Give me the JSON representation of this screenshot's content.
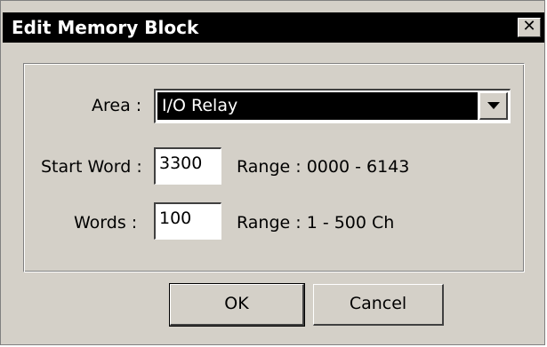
{
  "window": {
    "title": "Edit Memory Block",
    "close_glyph": "✕"
  },
  "form": {
    "area_label": "Area :",
    "area_value": "I/O Relay",
    "start_word_label": "Start Word :",
    "start_word_value": "3300",
    "start_word_range": "Range : 0000 - 6143",
    "words_label": "Words :",
    "words_value": "100",
    "words_range": "Range : 1 - 500 Ch"
  },
  "buttons": {
    "ok_label": "OK",
    "cancel_label": "Cancel"
  }
}
